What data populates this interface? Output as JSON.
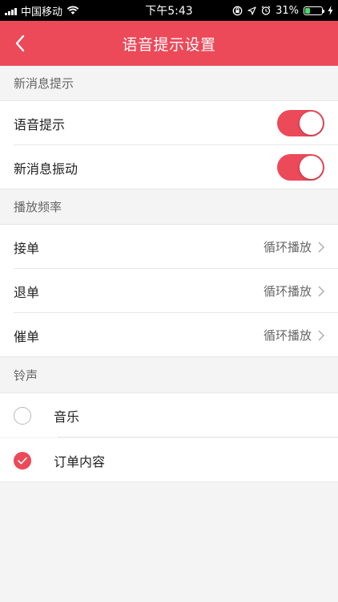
{
  "status_bar": {
    "carrier": "中国移动",
    "time": "下午5:43",
    "battery": "31%",
    "battery_level": 0.31,
    "icons": [
      "signal-bars-icon",
      "wifi-icon",
      "orientation-lock-icon",
      "location-icon",
      "alarm-icon",
      "battery-icon",
      "charging-icon"
    ]
  },
  "nav": {
    "title": "语音提示设置",
    "back_icon": "chevron-left-icon"
  },
  "colors": {
    "accent": "#ec4959",
    "background": "#f4f4f4"
  },
  "sections": {
    "new_message": {
      "title": "新消息提示",
      "items": [
        {
          "label": "语音提示",
          "enabled": true
        },
        {
          "label": "新消息振动",
          "enabled": true
        }
      ]
    },
    "frequency": {
      "title": "播放频率",
      "items": [
        {
          "label": "接单",
          "value": "循环播放"
        },
        {
          "label": "退单",
          "value": "循环播放"
        },
        {
          "label": "催单",
          "value": "循环播放"
        }
      ]
    },
    "ringtone": {
      "title": "铃声",
      "options": [
        {
          "label": "音乐",
          "selected": false
        },
        {
          "label": "订单内容",
          "selected": true
        }
      ]
    }
  }
}
